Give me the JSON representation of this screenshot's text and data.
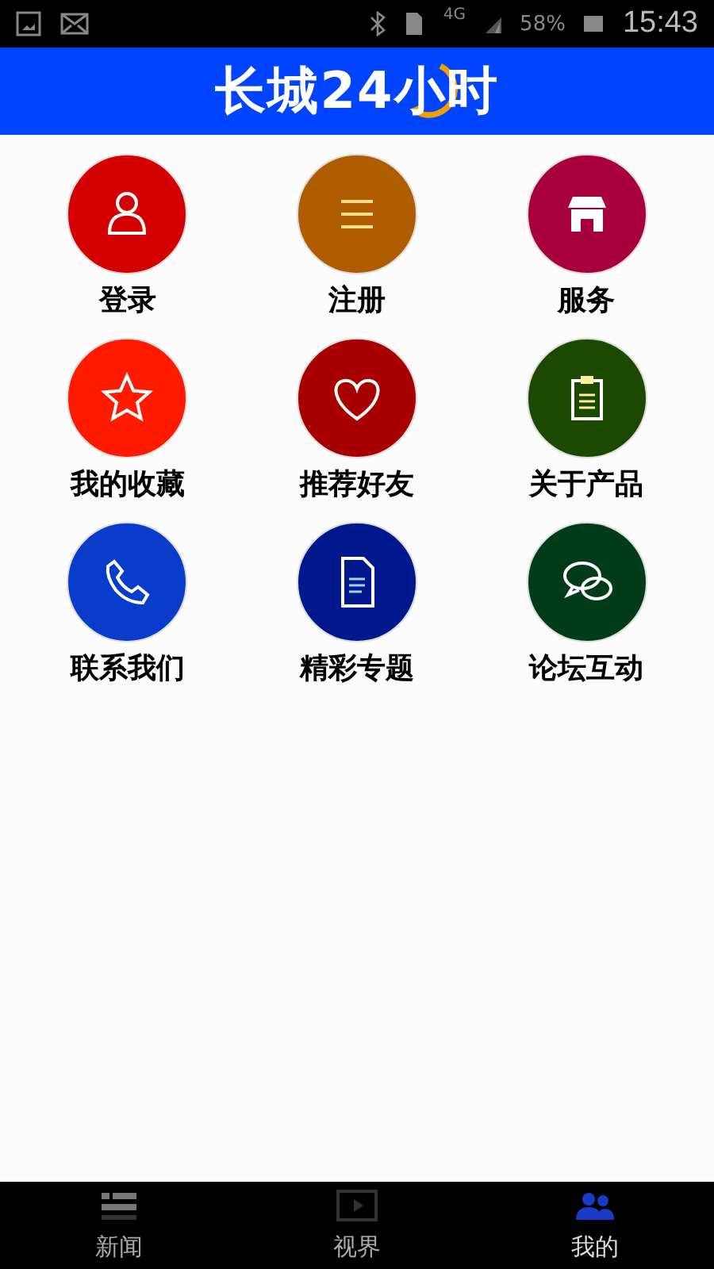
{
  "status_bar": {
    "network": "4G",
    "battery": "58%",
    "time": "15:43"
  },
  "header": {
    "logo_text": "长城24小时"
  },
  "grid": [
    {
      "label": "登录",
      "color": "#d40000"
    },
    {
      "label": "注册",
      "color": "#b05c00"
    },
    {
      "label": "服务",
      "color": "#a8003c"
    },
    {
      "label": "我的收藏",
      "color": "#ff1a00"
    },
    {
      "label": "推荐好友",
      "color": "#a80000"
    },
    {
      "label": "关于产品",
      "color": "#1c4800"
    },
    {
      "label": "联系我们",
      "color": "#0a3ccc"
    },
    {
      "label": "精彩专题",
      "color": "#00188c"
    },
    {
      "label": "论坛互动",
      "color": "#003c1c"
    }
  ],
  "bottom_nav": [
    {
      "label": "新闻",
      "selected": false
    },
    {
      "label": "视界",
      "selected": false
    },
    {
      "label": "我的",
      "selected": true
    }
  ]
}
